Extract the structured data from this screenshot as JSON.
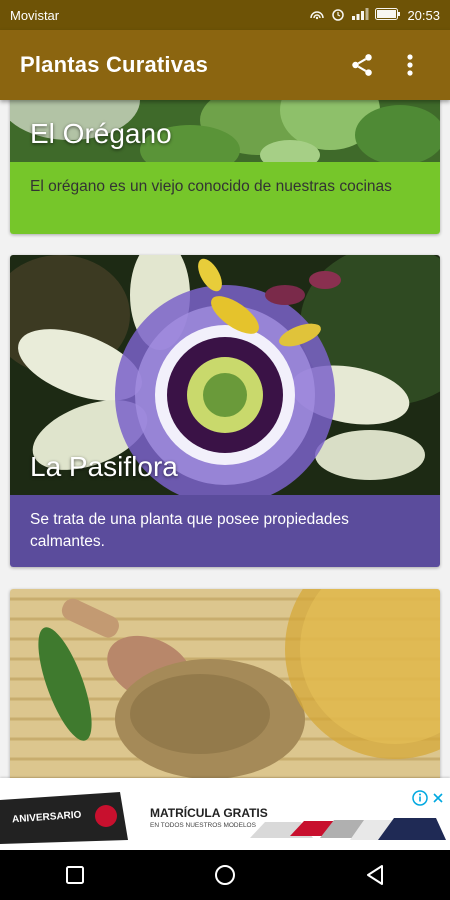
{
  "status_bar": {
    "carrier": "Movistar",
    "time": "20:53",
    "icons": [
      "hotspot-icon",
      "alarm-icon",
      "signal-icon",
      "battery-icon"
    ]
  },
  "app_bar": {
    "title": "Plantas Curativas",
    "actions": [
      "share-icon",
      "more-vert-icon"
    ]
  },
  "cards": [
    {
      "title": "El Orégano",
      "description": "El orégano es un viejo conocido de nuestras cocinas",
      "color": "#76c62a"
    },
    {
      "title": "La Pasiflora",
      "description": "Se trata de una planta que posee propiedades calmantes.",
      "color": "#5b4c9c"
    },
    {
      "title": "",
      "description": "",
      "color": "#d9b870"
    }
  ],
  "ad_banner": {
    "badge": "ANIVERSARIO",
    "headline": "MATRÍCULA GRATIS",
    "subline": "EN TODOS NUESTROS MODELOS",
    "info_icon": "info-icon",
    "close_icon": "close-icon"
  },
  "nav_bar": {
    "buttons": [
      "recents-square-icon",
      "home-circle-icon",
      "back-triangle-icon"
    ]
  }
}
